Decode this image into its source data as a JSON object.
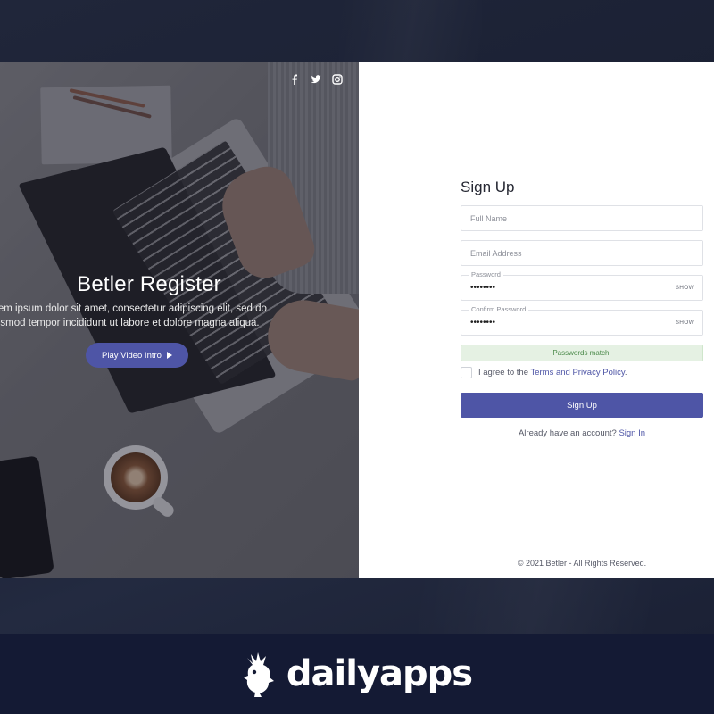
{
  "hero": {
    "socials": [
      "facebook-icon",
      "twitter-icon",
      "instagram-icon"
    ],
    "title": "Betler Register",
    "text_line1": "rem ipsum dolor sit amet, consectetur adipiscing elit, sed do",
    "text_line2": "usmod tempor incididunt ut labore et dolore magna aliqua.",
    "play_button": "Play Video Intro"
  },
  "form": {
    "title": "Sign Up",
    "full_name": {
      "placeholder": "Full Name",
      "value": ""
    },
    "email": {
      "placeholder": "Email Address",
      "value": ""
    },
    "password": {
      "label": "Password",
      "value": "••••••••",
      "show": "SHOW"
    },
    "confirm_password": {
      "label": "Confirm Password",
      "value": "••••••••",
      "show": "SHOW"
    },
    "match_message": "Passwords match!",
    "agree_prefix": "I agree to the",
    "agree_link": "Terms and Privacy Policy",
    "agree_suffix": ".",
    "submit": "Sign Up",
    "already_text": "Already have an account?",
    "signin_link": "Sign In",
    "copyright": "© 2021 Betler - All Rights Reserved."
  },
  "brand": {
    "name": "dailyapps"
  },
  "colors": {
    "accent": "#4e55a6",
    "frame": "#1b2135",
    "brand_bar": "#141a34",
    "success_bg": "#e5f1e3"
  }
}
